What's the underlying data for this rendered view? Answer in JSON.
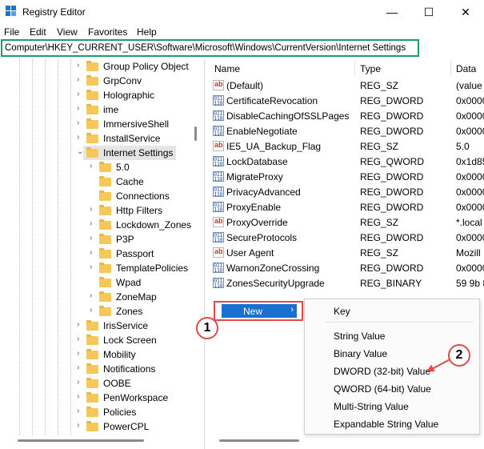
{
  "window": {
    "title": "Registry Editor",
    "controls": {
      "minimize": "—",
      "maximize": "☐",
      "close": "✕"
    }
  },
  "menu": [
    "File",
    "Edit",
    "View",
    "Favorites",
    "Help"
  ],
  "address": "Computer\\HKEY_CURRENT_USER\\Software\\Microsoft\\Windows\\CurrentVersion\\Internet Settings",
  "tree": {
    "items": [
      {
        "label": "Group Policy Object",
        "level": 0,
        "expander": "›"
      },
      {
        "label": "GrpConv",
        "level": 0,
        "expander": "›"
      },
      {
        "label": "Holographic",
        "level": 0,
        "expander": "›"
      },
      {
        "label": "ime",
        "level": 0,
        "expander": "›"
      },
      {
        "label": "ImmersiveShell",
        "level": 0,
        "expander": "›"
      },
      {
        "label": "InstallService",
        "level": 0,
        "expander": "›"
      },
      {
        "label": "Internet Settings",
        "level": 0,
        "expander": "⌄",
        "selected": true
      },
      {
        "label": "5.0",
        "level": 1,
        "expander": "›"
      },
      {
        "label": "Cache",
        "level": 1,
        "expander": ""
      },
      {
        "label": "Connections",
        "level": 1,
        "expander": ""
      },
      {
        "label": "Http Filters",
        "level": 1,
        "expander": "›"
      },
      {
        "label": "Lockdown_Zones",
        "level": 1,
        "expander": "›"
      },
      {
        "label": "P3P",
        "level": 1,
        "expander": "›"
      },
      {
        "label": "Passport",
        "level": 1,
        "expander": "›"
      },
      {
        "label": "TemplatePolicies",
        "level": 1,
        "expander": "›"
      },
      {
        "label": "Wpad",
        "level": 1,
        "expander": ""
      },
      {
        "label": "ZoneMap",
        "level": 1,
        "expander": "›"
      },
      {
        "label": "Zones",
        "level": 1,
        "expander": "›"
      },
      {
        "label": "IrisService",
        "level": 0,
        "expander": "›"
      },
      {
        "label": "Lock Screen",
        "level": 0,
        "expander": "›"
      },
      {
        "label": "Mobility",
        "level": 0,
        "expander": "›"
      },
      {
        "label": "Notifications",
        "level": 0,
        "expander": "›"
      },
      {
        "label": "OOBE",
        "level": 0,
        "expander": "›"
      },
      {
        "label": "PenWorkspace",
        "level": 0,
        "expander": "›"
      },
      {
        "label": "Policies",
        "level": 0,
        "expander": "›"
      },
      {
        "label": "PowerCPL",
        "level": 0,
        "expander": "›"
      }
    ]
  },
  "list": {
    "columns": {
      "name": "Name",
      "type": "Type",
      "data": "Data"
    },
    "rows": [
      {
        "name": "(Default)",
        "type": "REG_SZ",
        "data": "(value",
        "icon": "string"
      },
      {
        "name": "CertificateRevocation",
        "type": "REG_DWORD",
        "data": "0x0000",
        "icon": "binary"
      },
      {
        "name": "DisableCachingOfSSLPages",
        "type": "REG_DWORD",
        "data": "0x0000",
        "icon": "binary"
      },
      {
        "name": "EnableNegotiate",
        "type": "REG_DWORD",
        "data": "0x0000",
        "icon": "binary"
      },
      {
        "name": "IE5_UA_Backup_Flag",
        "type": "REG_SZ",
        "data": "5.0",
        "icon": "string"
      },
      {
        "name": "LockDatabase",
        "type": "REG_QWORD",
        "data": "0x1d85",
        "icon": "binary"
      },
      {
        "name": "MigrateProxy",
        "type": "REG_DWORD",
        "data": "0x0000",
        "icon": "binary"
      },
      {
        "name": "PrivacyAdvanced",
        "type": "REG_DWORD",
        "data": "0x0000",
        "icon": "binary"
      },
      {
        "name": "ProxyEnable",
        "type": "REG_DWORD",
        "data": "0x0000",
        "icon": "binary"
      },
      {
        "name": "ProxyOverride",
        "type": "REG_SZ",
        "data": "*.local",
        "icon": "string"
      },
      {
        "name": "SecureProtocols",
        "type": "REG_DWORD",
        "data": "0x0000",
        "icon": "binary"
      },
      {
        "name": "User Agent",
        "type": "REG_SZ",
        "data": "Mozill",
        "icon": "string"
      },
      {
        "name": "WarnonZoneCrossing",
        "type": "REG_DWORD",
        "data": "0x0000",
        "icon": "binary"
      },
      {
        "name": "ZonesSecurityUpgrade",
        "type": "REG_BINARY",
        "data": "59 9b 8",
        "icon": "binary"
      }
    ]
  },
  "context_menu": {
    "new_label": "New",
    "new_arrow": "›"
  },
  "submenu": {
    "key": "Key",
    "items": [
      "String Value",
      "Binary Value",
      "DWORD (32-bit) Value",
      "QWORD (64-bit) Value",
      "Multi-String Value",
      "Expandable String Value"
    ]
  },
  "annotations": {
    "step1": "1",
    "step2": "2",
    "color": "#e04a4a"
  },
  "icons": {
    "string": "ab",
    "binary": "011 110"
  }
}
